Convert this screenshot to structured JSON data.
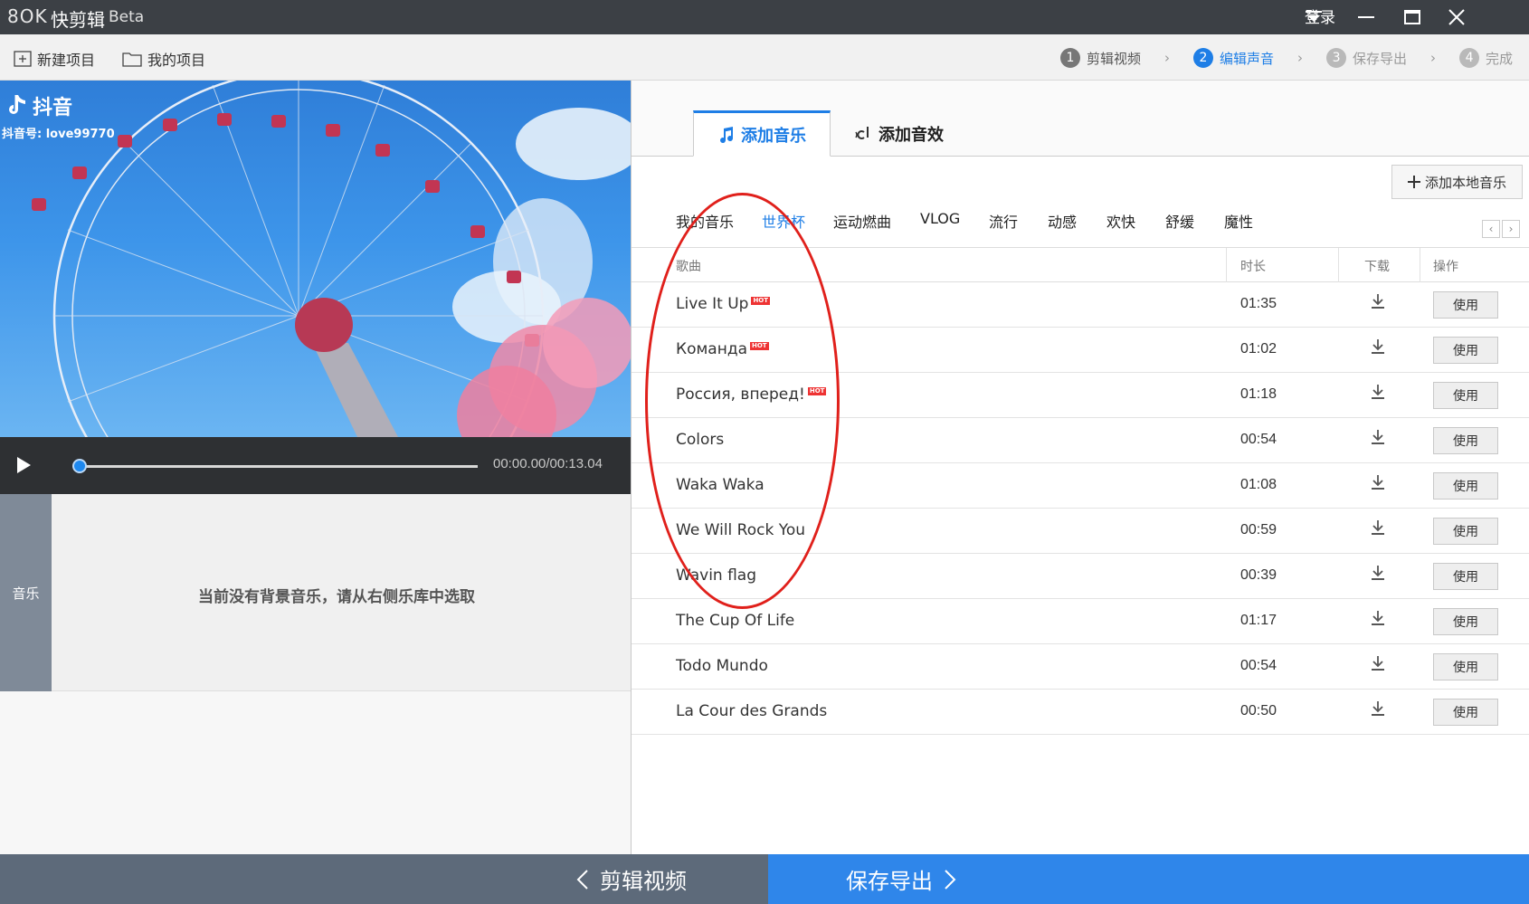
{
  "titlebar": {
    "logo": "8OK",
    "app_name": "快剪辑",
    "beta": "Beta",
    "login": "登录"
  },
  "toolbar": {
    "new_project": "新建项目",
    "my_projects": "我的项目",
    "steps": [
      {
        "num": "1",
        "label": "剪辑视频",
        "state": "done"
      },
      {
        "num": "2",
        "label": "编辑声音",
        "state": "active"
      },
      {
        "num": "3",
        "label": "保存导出",
        "state": "todo"
      },
      {
        "num": "4",
        "label": "完成",
        "state": "todo"
      }
    ]
  },
  "preview": {
    "brand": "抖音",
    "account": "抖音号: love99770"
  },
  "player": {
    "time": "00:00.00/00:13.04",
    "progress": 0
  },
  "music_track": {
    "label": "音乐",
    "empty_text": "当前没有背景音乐，请从右侧乐库中选取"
  },
  "tabs": {
    "add_music": "添加音乐",
    "add_effect": "添加音效"
  },
  "add_local": "添加本地音乐",
  "categories": [
    "我的音乐",
    "世界杯",
    "运动燃曲",
    "VLOG",
    "流行",
    "动感",
    "欢快",
    "舒缓",
    "魔性"
  ],
  "active_category": "世界杯",
  "table": {
    "headers": {
      "song": "歌曲",
      "duration": "时长",
      "download": "下载",
      "action": "操作"
    },
    "use_label": "使用",
    "hot_label": "HOT",
    "rows": [
      {
        "song": "Live It Up",
        "hot": true,
        "duration": "01:35"
      },
      {
        "song": "Команда",
        "hot": true,
        "duration": "01:02"
      },
      {
        "song": "Россия, вперед!",
        "hot": true,
        "duration": "01:18"
      },
      {
        "song": "Colors",
        "hot": false,
        "duration": "00:54"
      },
      {
        "song": "Waka Waka",
        "hot": false,
        "duration": "01:08"
      },
      {
        "song": "We Will Rock You",
        "hot": false,
        "duration": "00:59"
      },
      {
        "song": "Wavin flag",
        "hot": false,
        "duration": "00:39"
      },
      {
        "song": "The Cup Of Life",
        "hot": false,
        "duration": "01:17"
      },
      {
        "song": "Todo Mundo",
        "hot": false,
        "duration": "00:54"
      },
      {
        "song": "La Cour des Grands",
        "hot": false,
        "duration": "00:50"
      }
    ]
  },
  "bottom_nav": {
    "back": "剪辑视频",
    "next": "保存导出"
  },
  "colors": {
    "accent": "#1e7ee6",
    "annotation": "#e0201b",
    "nav_back": "#5d6a7a",
    "nav_next": "#2f86ea"
  }
}
